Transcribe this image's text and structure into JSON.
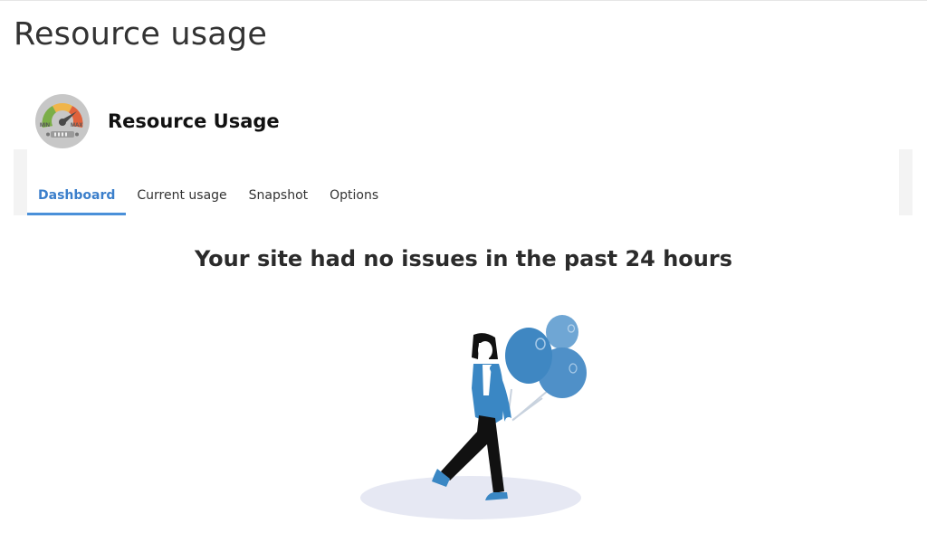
{
  "page": {
    "title": "Resource usage"
  },
  "plugin": {
    "name": "Resource Usage",
    "logo_icon": "gauge-icon",
    "logo_min_label": "MIN",
    "logo_max_label": "MAX"
  },
  "tabs": [
    {
      "label": "Dashboard",
      "active": true
    },
    {
      "label": "Current usage",
      "active": false
    },
    {
      "label": "Snapshot",
      "active": false
    },
    {
      "label": "Options",
      "active": false
    }
  ],
  "dashboard": {
    "headline": "Your site had no issues in the past 24 hours",
    "illustration": "woman-with-balloons-illustration"
  },
  "colors": {
    "accent": "#4a90d9",
    "balloon": "#3f87c2",
    "balloon_light": "#6fa6d4",
    "jacket": "#3a87c4"
  }
}
